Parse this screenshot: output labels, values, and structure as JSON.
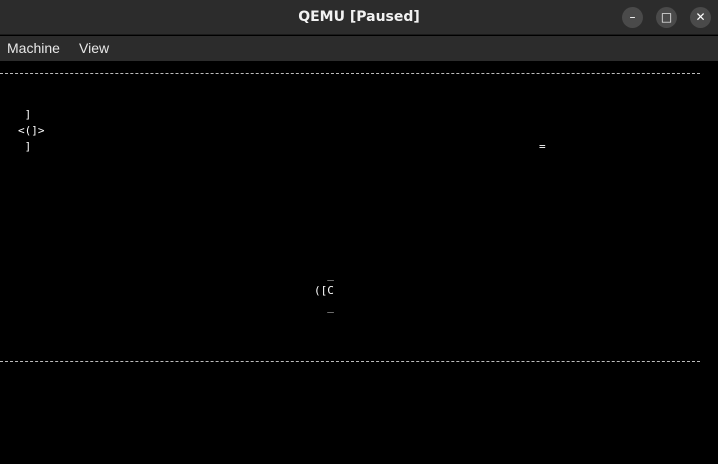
{
  "window": {
    "title": "QEMU [Paused]",
    "buttons": {
      "minimize": "–",
      "maximize": "□",
      "close": "✕"
    }
  },
  "menu": {
    "items": [
      "Machine",
      "View"
    ]
  },
  "screen": {
    "ship_a": " ]\n<(]>\n ]",
    "marker": "=",
    "ship_b": "  _\n([C\n  _"
  }
}
